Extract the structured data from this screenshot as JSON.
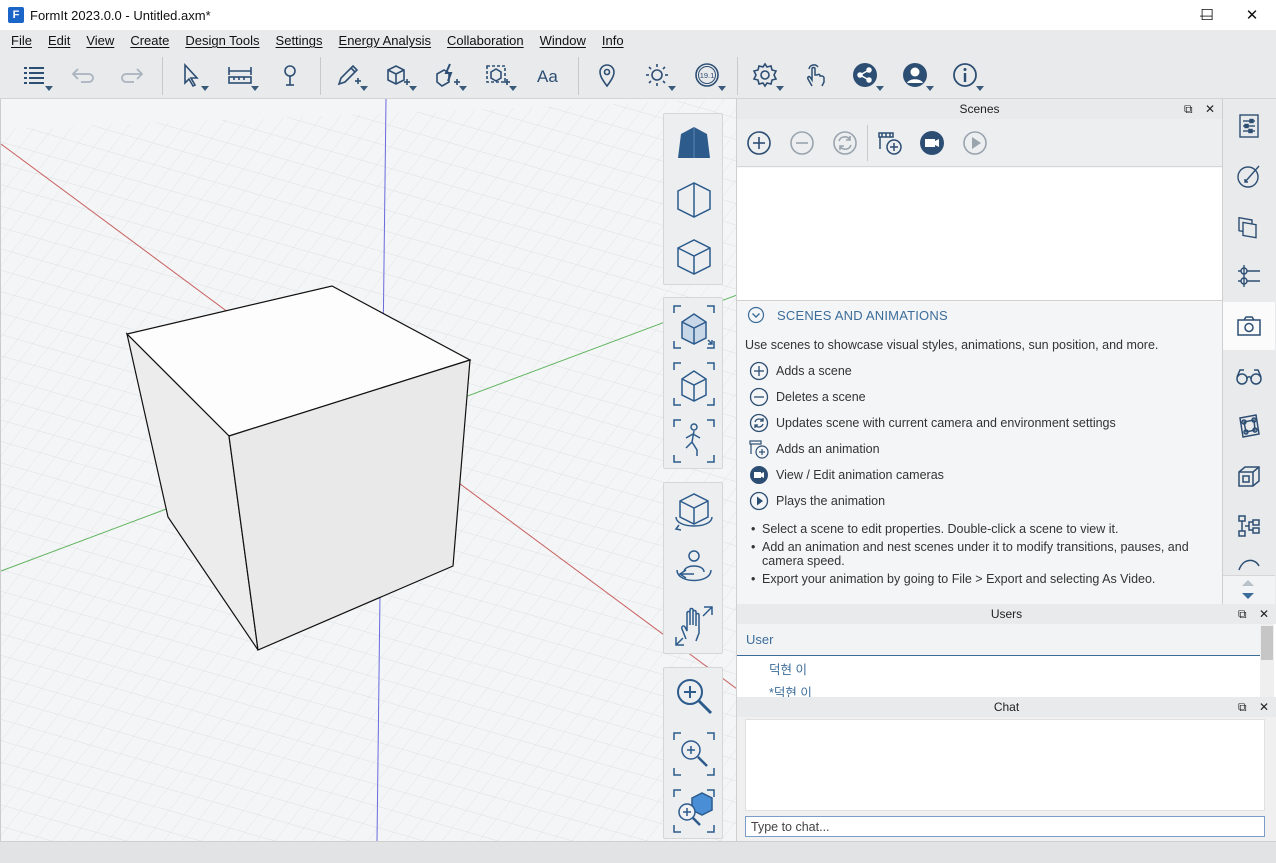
{
  "window": {
    "logo_letter": "F",
    "title": "FormIt 2023.0.0 - Untitled.axm*",
    "minimize_glyph": "—",
    "maximize_glyph": "☐",
    "close_glyph": "✕"
  },
  "menu": [
    "File",
    "Edit",
    "View",
    "Create",
    "Design Tools",
    "Settings",
    "Energy Analysis",
    "Collaboration",
    "Window",
    "Info"
  ],
  "toolbar": {
    "icons": [
      "layers-icon",
      "undo-icon",
      "redo-icon",
      "select-icon",
      "measure-icon",
      "tape-icon",
      "sketch-icon",
      "box-icon",
      "quick-tool-icon",
      "group-icon",
      "text-icon",
      "location-icon",
      "sun-icon",
      "version-icon",
      "settings-icon",
      "touch-icon",
      "share-icon",
      "account-icon",
      "info-icon"
    ],
    "version_badge": "19.1"
  },
  "scenes_panel": {
    "title": "Scenes",
    "dock_glyph": "⧉",
    "close_glyph": "✕",
    "help_title": "SCENES AND ANIMATIONS",
    "intro": "Use scenes to showcase visual styles, animations, sun position, and more.",
    "actions": [
      {
        "icon": "add-icon",
        "label": "Adds a scene"
      },
      {
        "icon": "remove-icon",
        "label": "Deletes a scene"
      },
      {
        "icon": "update-icon",
        "label": "Updates scene with current camera and environment settings"
      },
      {
        "icon": "add-animation-icon",
        "label": "Adds an animation"
      },
      {
        "icon": "camera-icon",
        "label": "View / Edit animation cameras"
      },
      {
        "icon": "play-icon",
        "label": "Plays the animation"
      }
    ],
    "bullets": [
      "Select a scene to edit properties. Double-click a scene to view it.",
      "Add an animation and nest scenes under it to modify transitions, pauses, and camera speed.",
      "Export your animation by going to File > Export and selecting As Video."
    ]
  },
  "right_rail": {
    "icons": [
      "properties-icon",
      "materials-icon",
      "layers-panel-icon",
      "levels-icon",
      "scenes-icon",
      "visual-styles-icon",
      "dynamo-icon",
      "groups-icon",
      "plugin-icon",
      "more-icon"
    ],
    "active": "scenes-icon"
  },
  "users_panel": {
    "title": "Users",
    "column": "User",
    "users": [
      "덕현 이",
      "*덕현 이"
    ],
    "dock_glyph": "⧉",
    "close_glyph": "✕"
  },
  "chat_panel": {
    "title": "Chat",
    "placeholder": "Type to chat...",
    "dock_glyph": "⧉",
    "close_glyph": "✕"
  },
  "view_toolbar": {
    "groups": [
      [
        "perspective-icon",
        "iso-icon",
        "ortho-cube-icon"
      ],
      [
        "camera-plan-icon",
        "camera-3d-icon",
        "walk-icon"
      ],
      [
        "orbit-icon",
        "look-around-icon",
        "pan-icon"
      ],
      [
        "zoom-icon",
        "zoom-window-icon",
        "zoom-extents-icon"
      ]
    ]
  }
}
